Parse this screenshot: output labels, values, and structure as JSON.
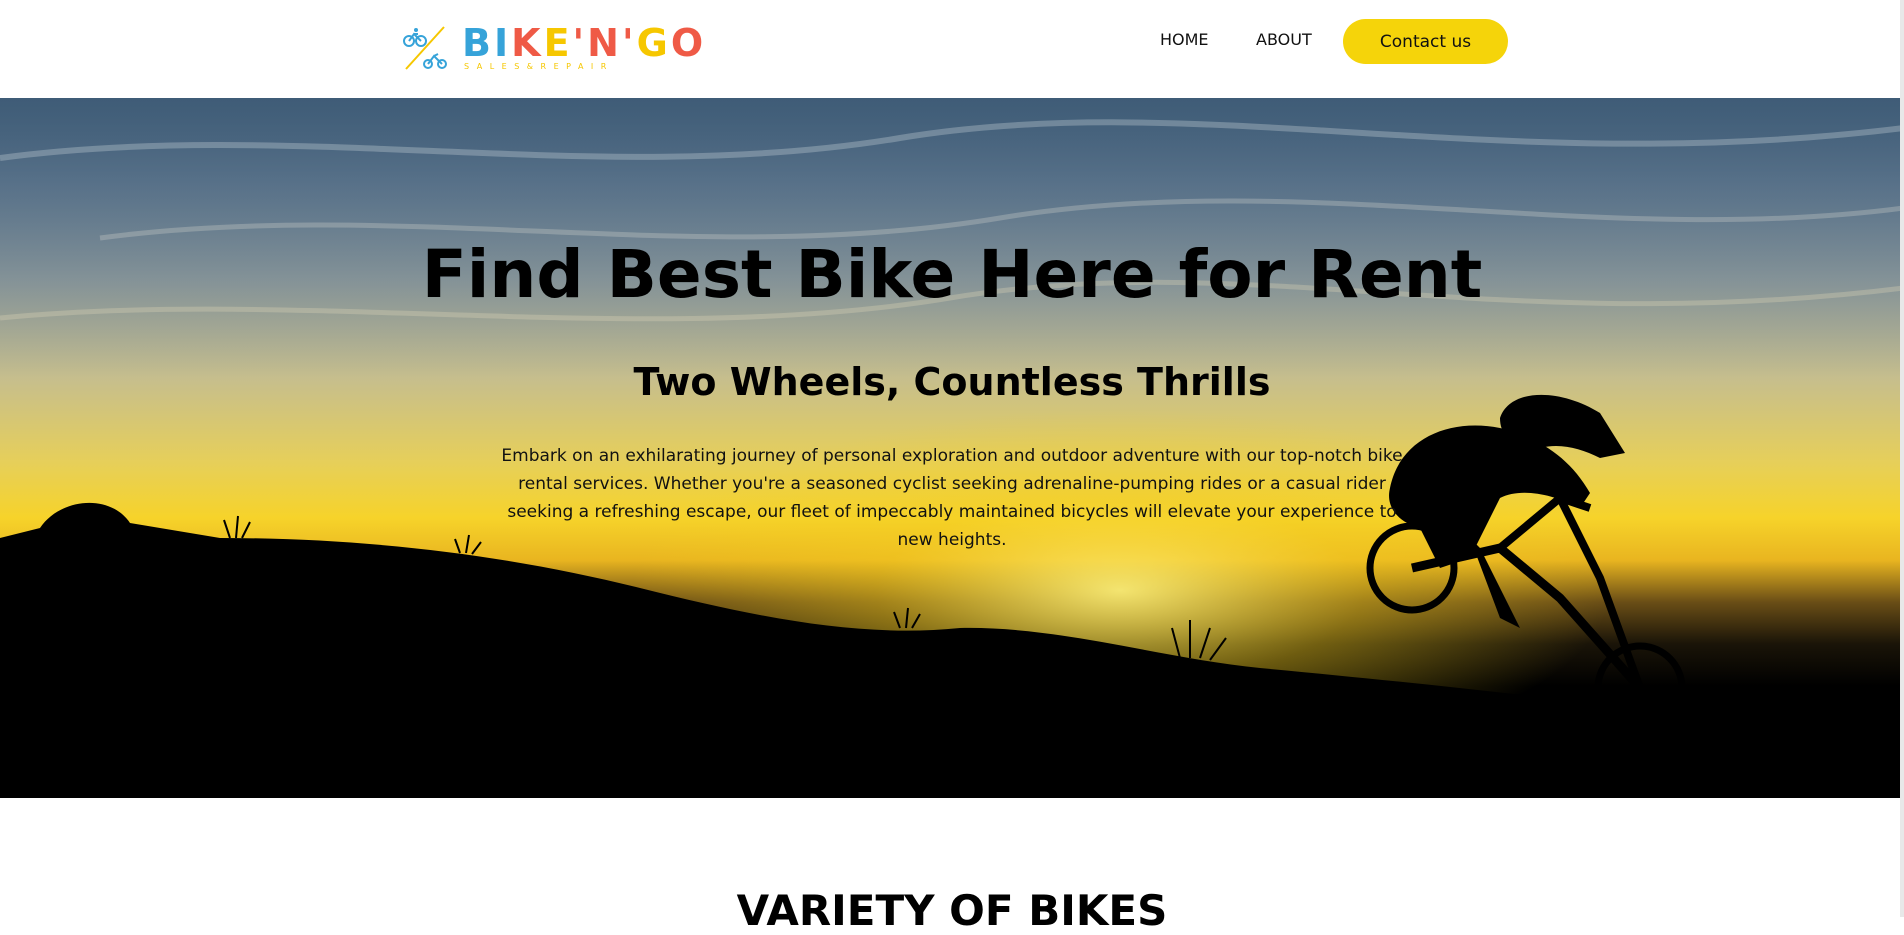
{
  "brand": {
    "logo_text": "BIKE'N'GO",
    "logo_tagline": "SALES&REPAIR",
    "colors": {
      "blue": "#36a3d9",
      "green": "#8bc34a",
      "yellow": "#f6c700",
      "red": "#ef5a46",
      "purple": "#9c6bd3"
    }
  },
  "nav": {
    "items": [
      {
        "label": "HOME"
      },
      {
        "label": "ABOUT"
      }
    ],
    "cta_label": "Contact us",
    "cta_color": "#f5d40a"
  },
  "hero": {
    "title": "Find Best Bike Here for Rent",
    "subtitle": "Two Wheels, Countless Thrills",
    "description": "Embark on an exhilarating journey of personal exploration and outdoor adventure with our top-notch bike rental services. Whether you're a seasoned cyclist seeking adrenaline-pumping rides or a casual rider seeking a refreshing escape, our fleet of impeccably maintained bicycles will elevate your experience to new heights.",
    "image": "sunset-mountain-biker-silhouette"
  },
  "sections": {
    "variety_title": "VARIETY OF BIKES"
  }
}
